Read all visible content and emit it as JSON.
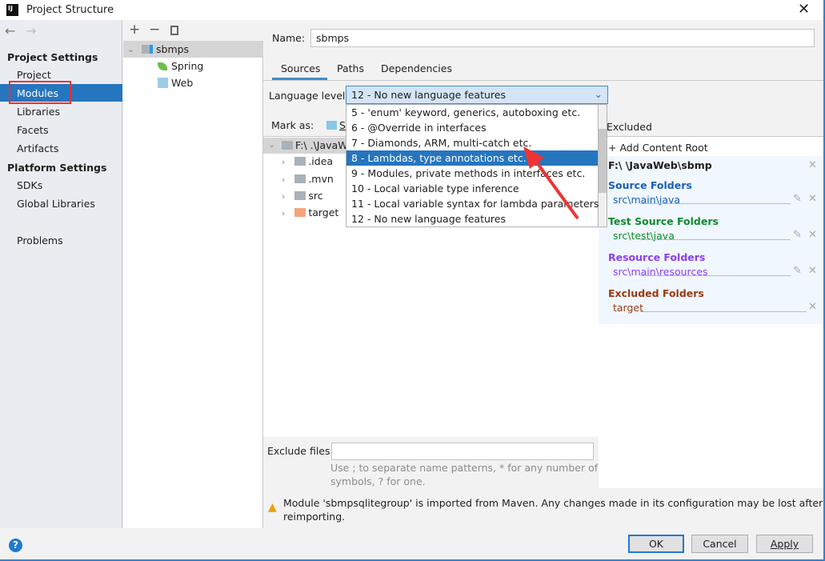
{
  "window": {
    "title": "Project Structure",
    "logo": "IJ"
  },
  "nav": {
    "back": "←",
    "forward": "→"
  },
  "sidebar": {
    "project_settings": "Project Settings",
    "items": [
      "Project",
      "Modules",
      "Libraries",
      "Facets",
      "Artifacts"
    ],
    "platform_settings": "Platform Settings",
    "platform_items": [
      "SDKs",
      "Global Libraries"
    ],
    "problems": "Problems",
    "selected": "Modules"
  },
  "modules_tree": {
    "toolbar": [
      "+",
      "−",
      "copy"
    ],
    "module": "sbmps",
    "facets": [
      "Spring",
      "Web"
    ]
  },
  "main": {
    "name_label": "Name:",
    "name_value": "sbmps",
    "tabs": [
      "Sources",
      "Paths",
      "Dependencies"
    ],
    "active_tab": "Sources",
    "language_level_label": "Language level:",
    "language_level_value": "12 - No new language features",
    "language_options": [
      "5 - 'enum' keyword, generics, autoboxing etc.",
      "6 - @Override in interfaces",
      "7 - Diamonds, ARM, multi-catch etc.",
      "8 - Lambdas, type annotations etc.",
      "9 - Modules, private methods in interfaces etc.",
      "10 - Local variable type inference",
      "11 - Local variable syntax for lambda parameters",
      "12 - No new language features"
    ],
    "highlighted_option": "8 - Lambdas, type annotations etc.",
    "mark_as_label": "Mark as:",
    "mark_as_first": "S",
    "excluded_label": "Excluded",
    "tree": {
      "root": "F:\\  .\\JavaW",
      "children": [
        ".idea",
        ".mvn",
        "src",
        "target"
      ]
    },
    "content_root": {
      "add": "Add Content Root",
      "path": "F:\\   \\JavaWeb\\sbmp",
      "groups": [
        {
          "title": "Source Folders",
          "path": "src\\main\\java",
          "color": "#1a5fb4"
        },
        {
          "title": "Test Source Folders",
          "path": "src\\test\\java",
          "color": "#118a2f"
        },
        {
          "title": "Resource Folders",
          "path": "src\\main\\resources",
          "color": "#8b3ff0"
        },
        {
          "title": "Excluded Folders",
          "path": "target",
          "color": "#9a3a10"
        }
      ]
    },
    "exclude_label": "Exclude files:",
    "exclude_value": "",
    "hint1": "Use ; to separate name patterns, * for any number of",
    "hint2": "symbols, ? for one.",
    "warning1": "Module 'sbmpsqlitegroup' is imported from Maven. Any changes made in its configuration may be lost after",
    "warning2": "reimporting."
  },
  "buttons": {
    "ok": "OK",
    "cancel": "Cancel",
    "apply": "Apply",
    "help": "?"
  },
  "colors": {
    "accent": "#2675bf",
    "annotation": "#ee3333"
  }
}
